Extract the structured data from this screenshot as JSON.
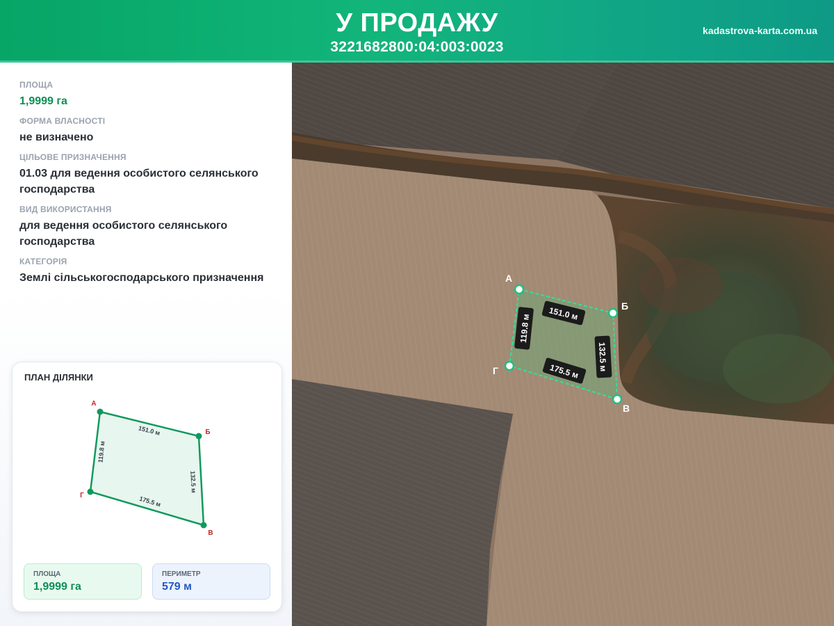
{
  "header": {
    "title": "У ПРОДАЖУ",
    "cadastral_number": "3221682800:04:003:0023",
    "site": "kadastrova-karta.com.ua"
  },
  "info": {
    "area": {
      "label": "ПЛОЩА",
      "value": "1,9999 га"
    },
    "ownership": {
      "label": "ФОРМА ВЛАСНОСТІ",
      "value": "не визначено"
    },
    "purpose": {
      "label": "ЦІЛЬОВЕ ПРИЗНАЧЕННЯ",
      "value": "01.03 для ведення особистого селянського господарства"
    },
    "usage": {
      "label": "ВИД ВИКОРИСТАННЯ",
      "value": "для ведення особистого селянського господарства"
    },
    "category": {
      "label": "КАТЕГОРІЯ",
      "value": "Землі сільськогосподарського призначення"
    }
  },
  "plan": {
    "title": "ПЛАН ДІЛЯНКИ",
    "points": {
      "a": "А",
      "b": "Б",
      "v": "В",
      "g": "Г"
    },
    "sides": {
      "ab": "151.0 м",
      "bv": "132.5 м",
      "vg": "175.5 м",
      "ga": "119.8 м"
    },
    "area": {
      "label": "ПЛОЩА",
      "value": "1,9999 га"
    },
    "perimeter": {
      "label": "ПЕРИМЕТР",
      "value": "579 м"
    }
  },
  "map": {
    "points": {
      "a": "А",
      "b": "Б",
      "v": "В",
      "g": "Г"
    },
    "sides": {
      "ab": "151.0 м",
      "bv": "132.5 м",
      "vg": "175.5 м",
      "ga": "119.8 м"
    }
  },
  "colors": {
    "brand": "#10b077",
    "accent_green": "#0e8f55",
    "accent_blue": "#2457c5",
    "plot_outline": "#1fd18f",
    "vertex_label": "#c62828"
  }
}
